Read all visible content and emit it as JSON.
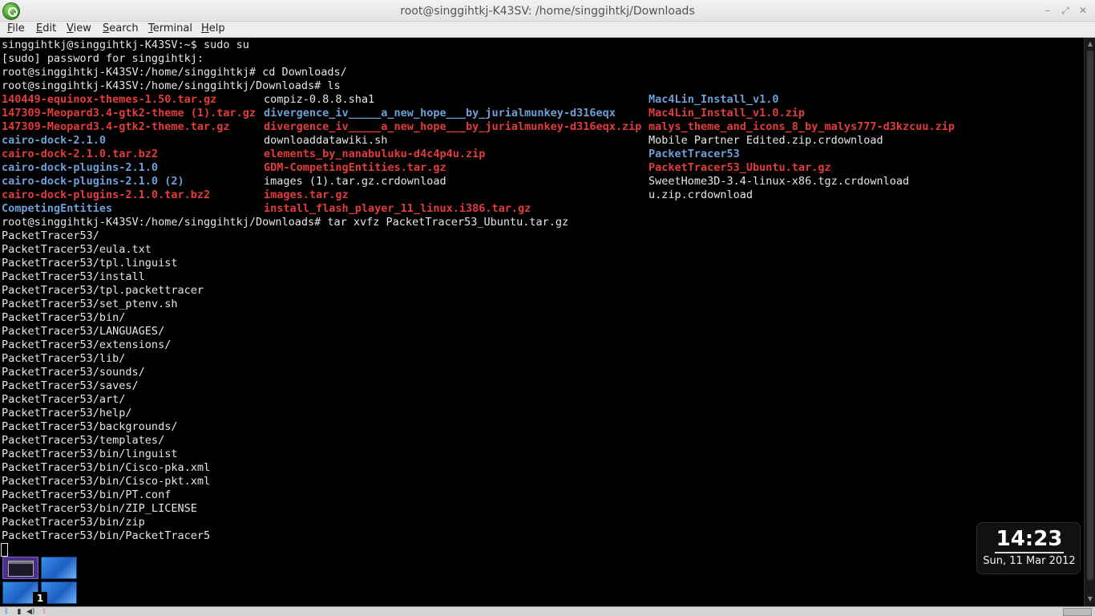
{
  "window": {
    "title": "root@singgihtkj-K43SV: /home/singgihtkj/Downloads",
    "minimize_glyph": "–",
    "maximize_glyph": "⤢",
    "close_glyph": "✕"
  },
  "menu": [
    {
      "acc": "F",
      "rest": "ile"
    },
    {
      "acc": "E",
      "rest": "dit"
    },
    {
      "acc": "V",
      "rest": "iew"
    },
    {
      "acc": "S",
      "rest": "earch"
    },
    {
      "acc": "T",
      "rest": "erminal"
    },
    {
      "acc": "H",
      "rest": "elp"
    }
  ],
  "terminal": {
    "prompt_lines": [
      "singgihtkj@singgihtkj-K43SV:~$ sudo su",
      "[sudo] password for singgihtkj:",
      "root@singgihtkj-K43SV:/home/singgihtkj# cd Downloads/",
      "root@singgihtkj-K43SV:/home/singgihtkj/Downloads# ls"
    ],
    "ls_columns": [
      [
        {
          "name": "140449-equinox-themes-1.50.tar.gz",
          "kind": "red"
        },
        {
          "name": "147309-Meopard3.4-gtk2-theme (1).tar.gz",
          "kind": "red"
        },
        {
          "name": "147309-Meopard3.4-gtk2-theme.tar.gz",
          "kind": "red"
        },
        {
          "name": "cairo-dock-2.1.0",
          "kind": "blue"
        },
        {
          "name": "cairo-dock-2.1.0.tar.bz2",
          "kind": "red"
        },
        {
          "name": "cairo-dock-plugins-2.1.0",
          "kind": "blue"
        },
        {
          "name": "cairo-dock-plugins-2.1.0 (2)",
          "kind": "blue"
        },
        {
          "name": "cairo-dock-plugins-2.1.0.tar.bz2",
          "kind": "red"
        },
        {
          "name": "CompetingEntities",
          "kind": "blue"
        }
      ],
      [
        {
          "name": "compiz-0.8.8.sha1",
          "kind": "plain"
        },
        {
          "name": "divergence_iv_____a_new_hope___by_jurialmunkey-d316eqx",
          "kind": "blue"
        },
        {
          "name": "divergence_iv_____a_new_hope___by_jurialmunkey-d316eqx.zip",
          "kind": "red"
        },
        {
          "name": "downloaddatawiki.sh",
          "kind": "plain"
        },
        {
          "name": "elements_by_nanabuluku-d4c4p4u.zip",
          "kind": "red"
        },
        {
          "name": "GDM-CompetingEntities.tar.gz",
          "kind": "red"
        },
        {
          "name": "images (1).tar.gz.crdownload",
          "kind": "plain"
        },
        {
          "name": "images.tar.gz",
          "kind": "red"
        },
        {
          "name": "install_flash_player_11_linux.i386.tar.gz",
          "kind": "red"
        }
      ],
      [
        {
          "name": "Mac4Lin_Install_v1.0",
          "kind": "blue"
        },
        {
          "name": "Mac4Lin_Install_v1.0.zip",
          "kind": "red"
        },
        {
          "name": "malys_theme_and_icons_8_by_malys777-d3kzcuu.zip",
          "kind": "red"
        },
        {
          "name": "Mobile Partner Edited.zip.crdownload",
          "kind": "plain"
        },
        {
          "name": "PacketTracer53",
          "kind": "blue"
        },
        {
          "name": "PacketTracer53_Ubuntu.tar.gz",
          "kind": "red"
        },
        {
          "name": "SweetHome3D-3.4-linux-x86.tgz.crdownload",
          "kind": "plain"
        },
        {
          "name": "u.zip.crdownload",
          "kind": "plain"
        }
      ]
    ],
    "after_lines": [
      "root@singgihtkj-K43SV:/home/singgihtkj/Downloads# tar xvfz PacketTracer53_Ubuntu.tar.gz",
      "PacketTracer53/",
      "PacketTracer53/eula.txt",
      "PacketTracer53/tpl.linguist",
      "PacketTracer53/install",
      "PacketTracer53/tpl.packettracer",
      "PacketTracer53/set_ptenv.sh",
      "PacketTracer53/bin/",
      "PacketTracer53/LANGUAGES/",
      "PacketTracer53/extensions/",
      "PacketTracer53/lib/",
      "PacketTracer53/sounds/",
      "PacketTracer53/saves/",
      "PacketTracer53/art/",
      "PacketTracer53/help/",
      "PacketTracer53/backgrounds/",
      "PacketTracer53/templates/",
      "PacketTracer53/bin/linguist",
      "PacketTracer53/bin/Cisco-pka.xml",
      "PacketTracer53/bin/Cisco-pkt.xml",
      "PacketTracer53/bin/PT.conf",
      "PacketTracer53/bin/ZIP_LICENSE",
      "PacketTracer53/bin/zip",
      "PacketTracer53/bin/PacketTracer5"
    ]
  },
  "workspaces": {
    "badge": "1"
  },
  "clock": {
    "time": "14:23",
    "date": "Sun, 11 Mar 2012"
  },
  "tray": {
    "bluetooth_glyph": "ᛒ",
    "battery_glyph": "▮",
    "volume_glyph": "◀)",
    "network_glyph": "⁝"
  }
}
